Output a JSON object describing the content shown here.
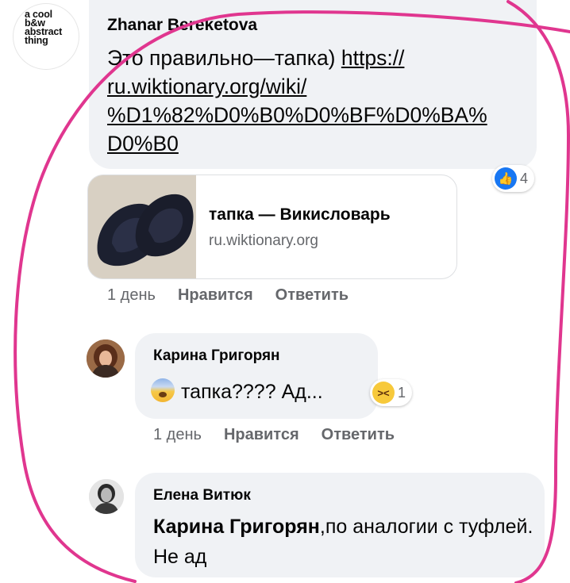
{
  "comments": [
    {
      "avatar_text": "a cool\nb&w\nabstract\nthing",
      "author": "Zhanar Bereketova",
      "text_prefix": "Это правильно—тапка) ",
      "link_text": "https://\nru.wiktionary.org/wiki/\n%D1%82%D0%B0%D0%BF%D0%BA%\nD0%B0",
      "reaction_count": "4",
      "reaction_icon": "like-icon",
      "link_preview": {
        "title": "тапка — Викисловарь",
        "domain": "ru.wiktionary.org"
      },
      "time": "1 день",
      "like_label": "Нравится",
      "reply_label": "Ответить"
    },
    {
      "author": "Карина Григорян",
      "text": "тапка???? Ад...",
      "emoji": "anxious-face-icon",
      "reaction_count": "1",
      "reaction_icon": "haha-icon",
      "time": "1 день",
      "like_label": "Нравится",
      "reply_label": "Ответить"
    },
    {
      "author": "Елена Витюк",
      "mention": "Карина Григорян",
      "text": ",по аналогии с туфлей. Не ад"
    }
  ],
  "colors": {
    "bubble": "#f0f2f5",
    "doodle": "#e0368f",
    "like_blue": "#1877f2",
    "meta_gray": "#65676b"
  }
}
